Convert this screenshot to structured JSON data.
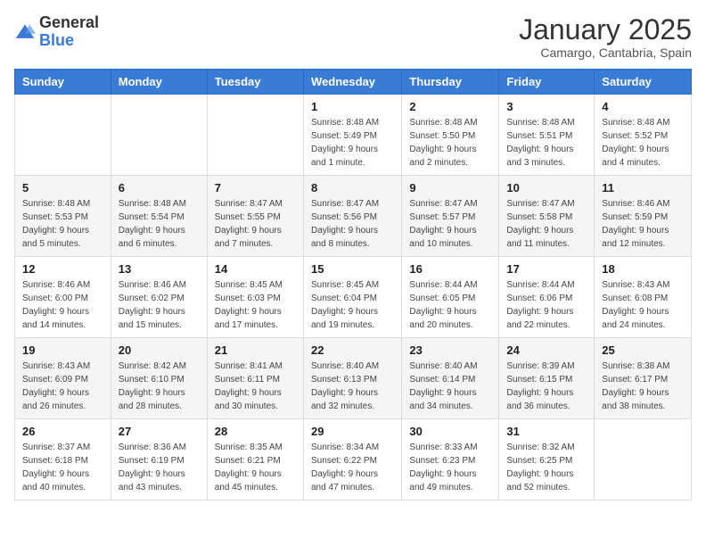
{
  "logo": {
    "general": "General",
    "blue": "Blue"
  },
  "header": {
    "title": "January 2025",
    "subtitle": "Camargo, Cantabria, Spain"
  },
  "days_of_week": [
    "Sunday",
    "Monday",
    "Tuesday",
    "Wednesday",
    "Thursday",
    "Friday",
    "Saturday"
  ],
  "weeks": [
    [
      {
        "day": "",
        "info": ""
      },
      {
        "day": "",
        "info": ""
      },
      {
        "day": "",
        "info": ""
      },
      {
        "day": "1",
        "info": "Sunrise: 8:48 AM\nSunset: 5:49 PM\nDaylight: 9 hours\nand 1 minute."
      },
      {
        "day": "2",
        "info": "Sunrise: 8:48 AM\nSunset: 5:50 PM\nDaylight: 9 hours\nand 2 minutes."
      },
      {
        "day": "3",
        "info": "Sunrise: 8:48 AM\nSunset: 5:51 PM\nDaylight: 9 hours\nand 3 minutes."
      },
      {
        "day": "4",
        "info": "Sunrise: 8:48 AM\nSunset: 5:52 PM\nDaylight: 9 hours\nand 4 minutes."
      }
    ],
    [
      {
        "day": "5",
        "info": "Sunrise: 8:48 AM\nSunset: 5:53 PM\nDaylight: 9 hours\nand 5 minutes."
      },
      {
        "day": "6",
        "info": "Sunrise: 8:48 AM\nSunset: 5:54 PM\nDaylight: 9 hours\nand 6 minutes."
      },
      {
        "day": "7",
        "info": "Sunrise: 8:47 AM\nSunset: 5:55 PM\nDaylight: 9 hours\nand 7 minutes."
      },
      {
        "day": "8",
        "info": "Sunrise: 8:47 AM\nSunset: 5:56 PM\nDaylight: 9 hours\nand 8 minutes."
      },
      {
        "day": "9",
        "info": "Sunrise: 8:47 AM\nSunset: 5:57 PM\nDaylight: 9 hours\nand 10 minutes."
      },
      {
        "day": "10",
        "info": "Sunrise: 8:47 AM\nSunset: 5:58 PM\nDaylight: 9 hours\nand 11 minutes."
      },
      {
        "day": "11",
        "info": "Sunrise: 8:46 AM\nSunset: 5:59 PM\nDaylight: 9 hours\nand 12 minutes."
      }
    ],
    [
      {
        "day": "12",
        "info": "Sunrise: 8:46 AM\nSunset: 6:00 PM\nDaylight: 9 hours\nand 14 minutes."
      },
      {
        "day": "13",
        "info": "Sunrise: 8:46 AM\nSunset: 6:02 PM\nDaylight: 9 hours\nand 15 minutes."
      },
      {
        "day": "14",
        "info": "Sunrise: 8:45 AM\nSunset: 6:03 PM\nDaylight: 9 hours\nand 17 minutes."
      },
      {
        "day": "15",
        "info": "Sunrise: 8:45 AM\nSunset: 6:04 PM\nDaylight: 9 hours\nand 19 minutes."
      },
      {
        "day": "16",
        "info": "Sunrise: 8:44 AM\nSunset: 6:05 PM\nDaylight: 9 hours\nand 20 minutes."
      },
      {
        "day": "17",
        "info": "Sunrise: 8:44 AM\nSunset: 6:06 PM\nDaylight: 9 hours\nand 22 minutes."
      },
      {
        "day": "18",
        "info": "Sunrise: 8:43 AM\nSunset: 6:08 PM\nDaylight: 9 hours\nand 24 minutes."
      }
    ],
    [
      {
        "day": "19",
        "info": "Sunrise: 8:43 AM\nSunset: 6:09 PM\nDaylight: 9 hours\nand 26 minutes."
      },
      {
        "day": "20",
        "info": "Sunrise: 8:42 AM\nSunset: 6:10 PM\nDaylight: 9 hours\nand 28 minutes."
      },
      {
        "day": "21",
        "info": "Sunrise: 8:41 AM\nSunset: 6:11 PM\nDaylight: 9 hours\nand 30 minutes."
      },
      {
        "day": "22",
        "info": "Sunrise: 8:40 AM\nSunset: 6:13 PM\nDaylight: 9 hours\nand 32 minutes."
      },
      {
        "day": "23",
        "info": "Sunrise: 8:40 AM\nSunset: 6:14 PM\nDaylight: 9 hours\nand 34 minutes."
      },
      {
        "day": "24",
        "info": "Sunrise: 8:39 AM\nSunset: 6:15 PM\nDaylight: 9 hours\nand 36 minutes."
      },
      {
        "day": "25",
        "info": "Sunrise: 8:38 AM\nSunset: 6:17 PM\nDaylight: 9 hours\nand 38 minutes."
      }
    ],
    [
      {
        "day": "26",
        "info": "Sunrise: 8:37 AM\nSunset: 6:18 PM\nDaylight: 9 hours\nand 40 minutes."
      },
      {
        "day": "27",
        "info": "Sunrise: 8:36 AM\nSunset: 6:19 PM\nDaylight: 9 hours\nand 43 minutes."
      },
      {
        "day": "28",
        "info": "Sunrise: 8:35 AM\nSunset: 6:21 PM\nDaylight: 9 hours\nand 45 minutes."
      },
      {
        "day": "29",
        "info": "Sunrise: 8:34 AM\nSunset: 6:22 PM\nDaylight: 9 hours\nand 47 minutes."
      },
      {
        "day": "30",
        "info": "Sunrise: 8:33 AM\nSunset: 6:23 PM\nDaylight: 9 hours\nand 49 minutes."
      },
      {
        "day": "31",
        "info": "Sunrise: 8:32 AM\nSunset: 6:25 PM\nDaylight: 9 hours\nand 52 minutes."
      },
      {
        "day": "",
        "info": ""
      }
    ]
  ]
}
